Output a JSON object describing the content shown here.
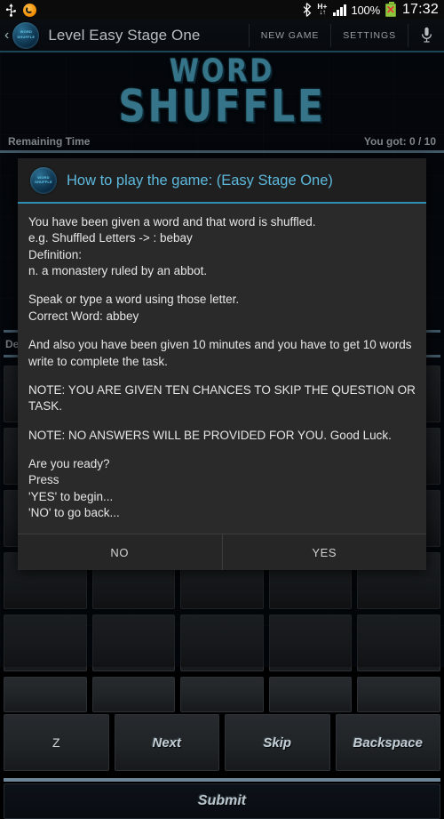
{
  "status_bar": {
    "usb_icon": "usb-icon",
    "sync_icon": "sync-icon",
    "bluetooth_icon": "bluetooth-icon",
    "network_type": "H+",
    "network_arrows": "↓↑",
    "signal_icon": "signal-bars-icon",
    "battery_percent": "100%",
    "battery_icon": "battery-charging-icon",
    "time": "17:32"
  },
  "action_bar": {
    "back_chevron": "‹",
    "app_icon_line1": "word",
    "app_icon_line2": "shuffle",
    "title": "Level Easy Stage One",
    "new_game_label": "NEW GAME",
    "settings_label": "SETTINGS",
    "mic_icon": "microphone-icon"
  },
  "logo": {
    "line1": "WORD",
    "line2": "SHUFFLE",
    "color": "#4ea8c4"
  },
  "info_strip": {
    "remaining_time_label": "Remaining Time",
    "score_label": "You got: 0 / 10",
    "accent_color": "#5d7f92"
  },
  "board": {
    "definition_label": "Def",
    "rows": [
      {
        "keys": [
          "",
          "",
          "",
          "",
          ""
        ]
      },
      {
        "keys": [
          "",
          "",
          "",
          "",
          ""
        ]
      },
      {
        "keys": [
          "",
          "",
          "",
          "",
          ""
        ]
      },
      {
        "keys": [
          "",
          "",
          "",
          "",
          ""
        ]
      },
      {
        "keys": [
          "",
          "",
          "",
          "",
          ""
        ]
      },
      {
        "keys": [
          "",
          "",
          "",
          "",
          ""
        ]
      },
      {
        "keys": [
          "Z",
          "Next",
          "Skip",
          "Backspace"
        ]
      }
    ],
    "submit_label": "Submit"
  },
  "dialog": {
    "icon_line1": "word",
    "icon_line2": "shuffle",
    "title": "How to play the game: (Easy Stage One)",
    "title_color": "#5db9dd",
    "paragraphs": [
      "You have been given a word and that word is shuffled.",
      "e.g. Shuffled Letters -> : bebay",
      "Definition:",
      "n. a monastery ruled by an abbot.",
      "Speak or type a word using those letter.",
      "Correct Word: abbey",
      "And also you have been given 10 minutes and you have to get 10 words write to complete the task.",
      "NOTE: YOU ARE GIVEN TEN CHANCES TO SKIP THE QUESTION OR TASK.",
      "NOTE: NO ANSWERS WILL BE PROVIDED FOR YOU. Good Luck.",
      "Are you ready?",
      "Press",
      "'YES' to begin...",
      "'NO' to go back..."
    ],
    "no_label": "NO",
    "yes_label": "YES"
  }
}
